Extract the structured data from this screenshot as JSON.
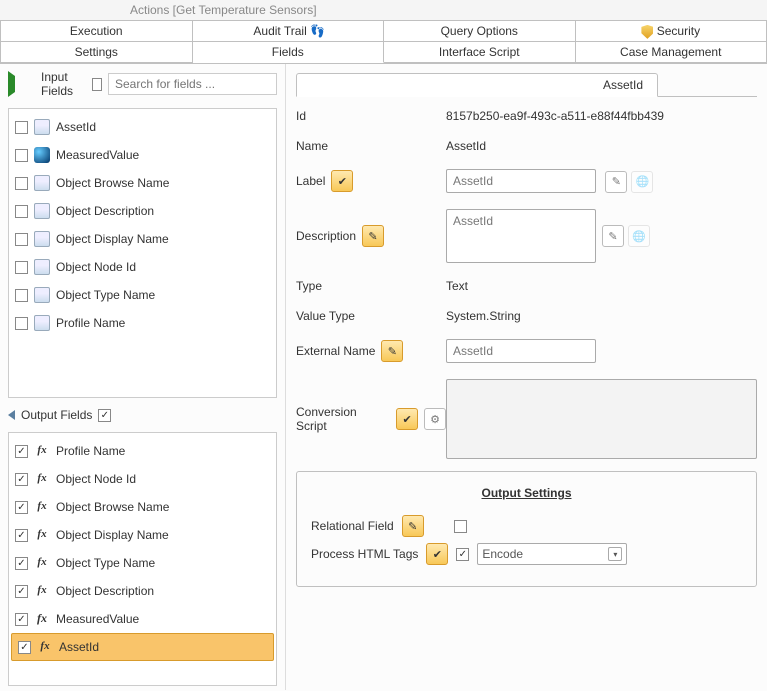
{
  "title": "Actions [Get Temperature Sensors]",
  "tabs_row1": [
    "Execution",
    "Audit Trail",
    "Query Options",
    "Security"
  ],
  "tabs_row2": [
    "Settings",
    "Fields",
    "Interface Script",
    "Case Management"
  ],
  "active_tab": "Fields",
  "left": {
    "input_label": "Input Fields",
    "input_checked": false,
    "search_placeholder": "Search for fields ...",
    "output_label": "Output Fields",
    "output_checked": true,
    "input_fields": [
      {
        "label": "AssetId",
        "icon": "doc",
        "checked": false
      },
      {
        "label": "MeasuredValue",
        "icon": "val",
        "checked": false
      },
      {
        "label": "Object Browse Name",
        "icon": "doc",
        "checked": false
      },
      {
        "label": "Object Description",
        "icon": "doc",
        "checked": false
      },
      {
        "label": "Object Display Name",
        "icon": "doc",
        "checked": false
      },
      {
        "label": "Object Node Id",
        "icon": "doc",
        "checked": false
      },
      {
        "label": "Object Type Name",
        "icon": "doc",
        "checked": false
      },
      {
        "label": "Profile Name",
        "icon": "doc",
        "checked": false
      }
    ],
    "output_fields": [
      {
        "label": "Profile Name",
        "checked": true,
        "bold": false
      },
      {
        "label": "Object Node Id",
        "checked": true,
        "bold": false
      },
      {
        "label": "Object Browse Name",
        "checked": true,
        "bold": false
      },
      {
        "label": "Object Display Name",
        "checked": true,
        "bold": false
      },
      {
        "label": "Object Type Name",
        "checked": true,
        "bold": false
      },
      {
        "label": "Object Description",
        "checked": true,
        "bold": false
      },
      {
        "label": "MeasuredValue",
        "checked": true,
        "bold": true
      },
      {
        "label": "AssetId",
        "checked": true,
        "bold": false,
        "selected": true
      }
    ]
  },
  "detail": {
    "tab_label": "AssetId",
    "id_label": "Id",
    "id_value": "8157b250-ea9f-493c-a511-e88f44fbb439",
    "name_label": "Name",
    "name_value": "AssetId",
    "label_label": "Label",
    "label_value": "AssetId",
    "desc_label": "Description",
    "desc_value": "AssetId",
    "type_label": "Type",
    "type_value": "Text",
    "vtype_label": "Value Type",
    "vtype_value": "System.String",
    "ext_label": "External Name",
    "ext_value": "AssetId",
    "conv_label": "Conversion Script"
  },
  "output_settings": {
    "heading": "Output Settings",
    "relational_label": "Relational Field",
    "relational_checked": false,
    "html_label": "Process HTML Tags",
    "html_checked": true,
    "html_mode": "Encode"
  }
}
